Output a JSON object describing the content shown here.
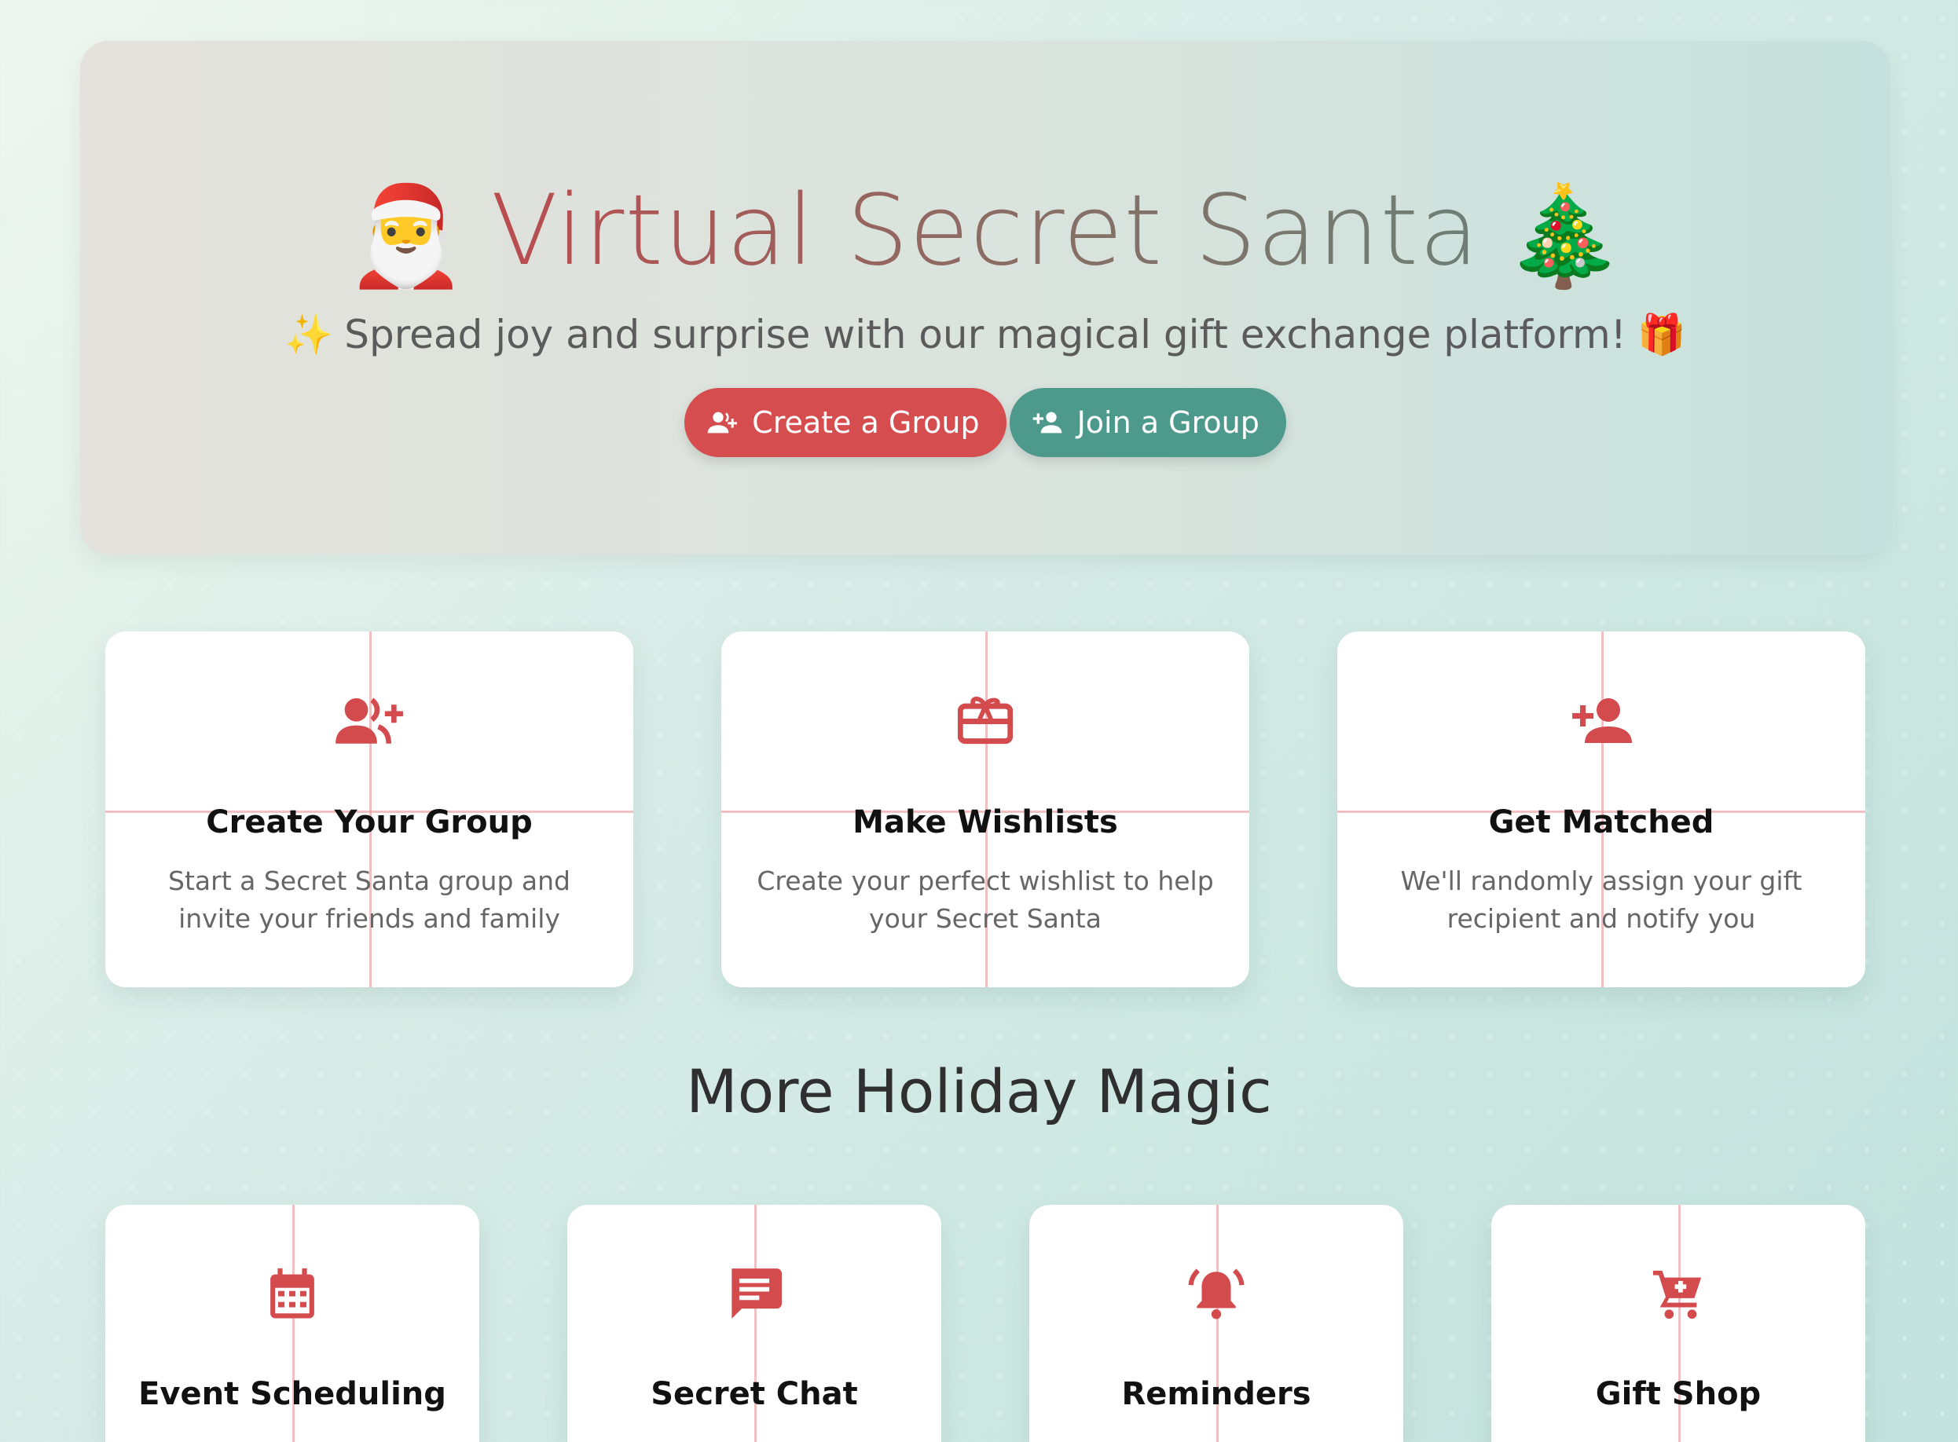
{
  "hero": {
    "title": "Virtual Secret Santa",
    "title_emoji_left": "🎅",
    "title_emoji_right": "🎄",
    "subtitle": "Spread joy and surprise with our magical gift exchange platform!",
    "subtitle_emoji_left": "✨",
    "subtitle_emoji_right": "🎁",
    "buttons": {
      "create_label": "Create a Group",
      "create_icon": "user-plus-icon",
      "join_label": "Join a Group",
      "join_icon": "person-add-icon"
    }
  },
  "steps": [
    {
      "icon": "user-plus-icon",
      "title": "Create Your Group",
      "description": "Start a Secret Santa group and invite your friends and family"
    },
    {
      "icon": "gift-card-icon",
      "title": "Make Wishlists",
      "description": "Create your perfect wishlist to help your Secret Santa"
    },
    {
      "icon": "person-add-icon",
      "title": "Get Matched",
      "description": "We'll randomly assign your gift recipient and notify you"
    }
  ],
  "more_section": {
    "title": "More Holiday Magic",
    "features": [
      {
        "icon": "calendar-icon",
        "title": "Event Scheduling"
      },
      {
        "icon": "chat-icon",
        "title": "Secret Chat"
      },
      {
        "icon": "bell-ring-icon",
        "title": "Reminders"
      },
      {
        "icon": "cart-icon",
        "title": "Gift Shop"
      }
    ]
  },
  "colors": {
    "primary_red": "#d64d4f",
    "teal": "#4d9a8d",
    "icon_red": "#d44b4e"
  }
}
